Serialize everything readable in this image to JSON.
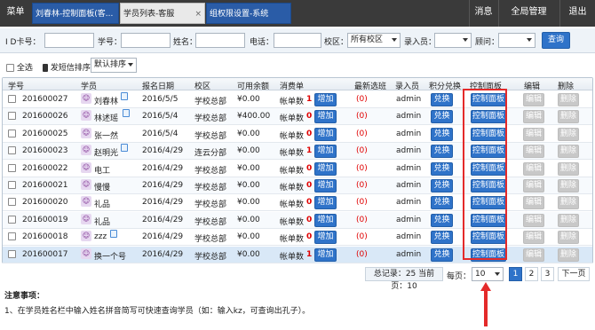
{
  "topbar": {
    "menu": "菜单",
    "tabs": [
      {
        "label": "刘春林-控制面板(客...",
        "closable": false
      },
      {
        "label": "学员列表-客服",
        "closable": true,
        "close": "×"
      },
      {
        "label": "组权限设置-系统",
        "closable": false
      }
    ],
    "right_menu": {
      "messages": "消息",
      "global": "全局管理",
      "exit": "退出"
    }
  },
  "filters": {
    "id_card": "I D卡号：",
    "student_no": "学号：",
    "name": "姓名：",
    "phone": "电话：",
    "campus": "校区：",
    "campus_value": "所有校区",
    "entry_person": "录入员：",
    "consultant": "顾问：",
    "query": "查询"
  },
  "toolbar": {
    "select_all": "全选",
    "sms_sort": "发短信排序：",
    "sort_value": "默认排序"
  },
  "table": {
    "headers": [
      "学号",
      "学员",
      "报名日期",
      "校区",
      "可用余额",
      "消费单",
      "最新选班",
      "录入员",
      "积分兑换",
      "控制面板",
      "编辑",
      "删除"
    ],
    "rows": [
      {
        "no": "201600027",
        "name": "刘春林",
        "date": "2016/5/5",
        "campus": "学校总部",
        "balance": "¥0.00",
        "bill_label": "帐单数",
        "bill_count": "1",
        "latest": "(0)",
        "entry": "admin"
      },
      {
        "no": "201600026",
        "name": "林述瑶",
        "date": "2016/5/4",
        "campus": "学校总部",
        "balance": "¥400.00",
        "bill_label": "帐单数",
        "bill_count": "0",
        "latest": "(0)",
        "entry": "admin"
      },
      {
        "no": "201600025",
        "name": "张一然",
        "date": "2016/5/4",
        "campus": "学校总部",
        "balance": "¥0.00",
        "bill_label": "帐单数",
        "bill_count": "0",
        "latest": "(0)",
        "entry": "admin"
      },
      {
        "no": "201600023",
        "name": "赵明光",
        "date": "2016/4/29",
        "campus": "连云分部",
        "balance": "¥0.00",
        "bill_label": "帐单数",
        "bill_count": "1",
        "latest": "(0)",
        "entry": "admin"
      },
      {
        "no": "201600022",
        "name": "电工",
        "date": "2016/4/29",
        "campus": "学校总部",
        "balance": "¥0.00",
        "bill_label": "帐单数",
        "bill_count": "0",
        "latest": "(0)",
        "entry": "admin"
      },
      {
        "no": "201600021",
        "name": "慢慢",
        "date": "2016/4/29",
        "campus": "学校总部",
        "balance": "¥0.00",
        "bill_label": "帐单数",
        "bill_count": "0",
        "latest": "(0)",
        "entry": "admin"
      },
      {
        "no": "201600020",
        "name": "礼品",
        "date": "2016/4/29",
        "campus": "学校总部",
        "balance": "¥0.00",
        "bill_label": "帐单数",
        "bill_count": "0",
        "latest": "(0)",
        "entry": "admin"
      },
      {
        "no": "201600019",
        "name": "礼品",
        "date": "2016/4/29",
        "campus": "学校总部",
        "balance": "¥0.00",
        "bill_label": "帐单数",
        "bill_count": "0",
        "latest": "(0)",
        "entry": "admin"
      },
      {
        "no": "201600018",
        "name": "zzz",
        "date": "2016/4/29",
        "campus": "学校总部",
        "balance": "¥0.00",
        "bill_label": "帐单数",
        "bill_count": "0",
        "latest": "(0)",
        "entry": "admin"
      },
      {
        "no": "201600017",
        "name": "换一个号",
        "date": "2016/4/29",
        "campus": "学校总部",
        "balance": "¥0.00",
        "bill_label": "帐单数",
        "bill_count": "1",
        "latest": "(0)",
        "entry": "admin"
      }
    ],
    "actions": {
      "add": "增加",
      "exchange": "兑换",
      "control": "控制面板",
      "edit": "编辑",
      "delete": "删除"
    }
  },
  "pager": {
    "summary": "总记录：25 当前页：10",
    "per_page_label": "每页：",
    "per_page_value": "10",
    "pages": [
      "1",
      "2",
      "3"
    ],
    "next": "下一页"
  },
  "notes": {
    "title": "注意事项：",
    "line1": "1、在学员姓名栏中输入姓名拼音简写可快速查询学员（如：输入kz，可查询出孔子）。"
  },
  "colors": {
    "accent": "#2f73c9",
    "highlight": "#e42a2a",
    "topbar": "#3a3a3a"
  }
}
